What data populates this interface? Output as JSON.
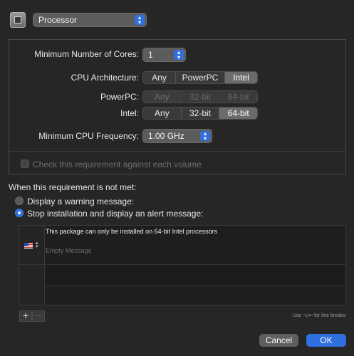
{
  "header": {
    "requirement_type": "Processor"
  },
  "panel": {
    "min_cores_label": "Minimum Number of Cores:",
    "min_cores_value": "1",
    "cpu_arch_label": "CPU Architecture:",
    "cpu_arch_options": [
      "Any",
      "PowerPC",
      "Intel"
    ],
    "powerpc_label": "PowerPC:",
    "powerpc_options": [
      "Any",
      "32-bit",
      "64-bit"
    ],
    "intel_label": "Intel:",
    "intel_options": [
      "Any",
      "32-bit",
      "64-bit"
    ],
    "min_freq_label": "Minimum CPU Frequency:",
    "min_freq_value": "1.00 GHz",
    "check_volume_label": "Check this requirement against each volume"
  },
  "not_met": {
    "heading": "When this requirement is not met:",
    "option_warning": "Display a warning message:",
    "option_stop": "Stop installation and display an alert message:"
  },
  "messages": {
    "title_text": "This package can only be installed on 64-bit Intel processors",
    "body_placeholder": "Empty Message"
  },
  "footer": {
    "add": "+",
    "remove": "—",
    "hint": "Use ⌥↩ for line breaks",
    "cancel": "Cancel",
    "ok": "OK"
  },
  "colors": {
    "accent": "#2f6fe0"
  }
}
